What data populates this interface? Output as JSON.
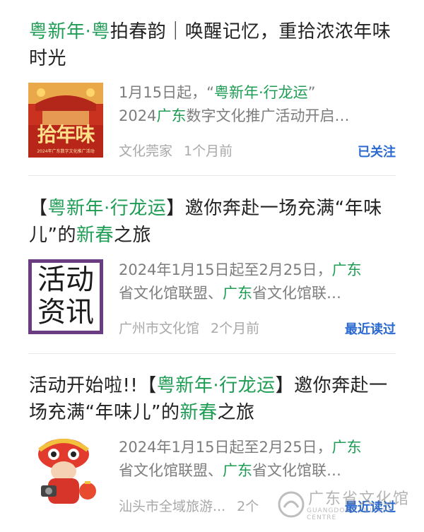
{
  "articles": [
    {
      "title_parts": [
        {
          "text": "粤新年·粤",
          "hl": true
        },
        {
          "text": "拍春韵｜唤醒记忆，重拾浓浓年味时光",
          "hl": false
        }
      ],
      "thumb_text": "拾年味",
      "thumb_caption": "2024年广东数字文化推广活动",
      "summary_line1": [
        {
          "text": "1月15日起，“",
          "hl": false
        },
        {
          "text": "粤新年·行龙运",
          "hl": true
        },
        {
          "text": "”",
          "hl": false
        }
      ],
      "summary_line2": [
        {
          "text": "2024",
          "hl": false
        },
        {
          "text": "广东",
          "hl": true
        },
        {
          "text": "数字文化推广活动开启…",
          "hl": false
        }
      ],
      "source": "文化莞家",
      "time": "1个月前",
      "action": "已关注"
    },
    {
      "title_parts": [
        {
          "text": "【",
          "hl": false
        },
        {
          "text": "粤新年·行龙运",
          "hl": true
        },
        {
          "text": "】邀你奔赴一场充满“年味儿”的",
          "hl": false
        },
        {
          "text": "新春",
          "hl": true
        },
        {
          "text": "之旅",
          "hl": false
        }
      ],
      "thumb_text_1": "活动",
      "thumb_text_2": "资讯",
      "summary_line1": [
        {
          "text": "2024年1月15日起至2月25日，",
          "hl": false
        },
        {
          "text": "广东",
          "hl": true
        }
      ],
      "summary_line2": [
        {
          "text": "省文化馆联盟、",
          "hl": false
        },
        {
          "text": "广东",
          "hl": true
        },
        {
          "text": "省文化馆联…",
          "hl": false
        }
      ],
      "source": "广州市文化馆",
      "time": "2个月前",
      "action": "最近读过"
    },
    {
      "title_parts": [
        {
          "text": "活动开始啦!!【",
          "hl": false
        },
        {
          "text": "粤新年·行龙运",
          "hl": true
        },
        {
          "text": "】邀你奔赴一场充满“年味儿”的",
          "hl": false
        },
        {
          "text": "新春",
          "hl": true
        },
        {
          "text": "之旅",
          "hl": false
        }
      ],
      "summary_line1": [
        {
          "text": "2024年1月15日起至2月25日，",
          "hl": false
        },
        {
          "text": "广东",
          "hl": true
        }
      ],
      "summary_line2": [
        {
          "text": "省文化馆联盟、",
          "hl": false
        },
        {
          "text": "广东",
          "hl": true
        },
        {
          "text": "省文化馆联…",
          "hl": false
        }
      ],
      "source": "汕头市全域旅游...",
      "time": "2个",
      "action": "最近读过"
    }
  ],
  "watermark": {
    "text": "广东省文化馆",
    "sub": "GUANGDONG CULTURE CENTRE"
  },
  "colors": {
    "highlight": "#1f9d55",
    "action": "#2b6ad1"
  }
}
